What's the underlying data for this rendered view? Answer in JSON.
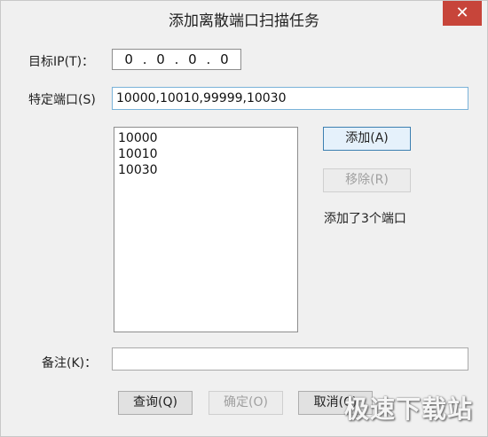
{
  "window": {
    "title": "添加离散端口扫描任务",
    "close_glyph": "✕"
  },
  "target_ip": {
    "label": "目标IP(T)：",
    "octets": [
      "0",
      "0",
      "0",
      "0"
    ]
  },
  "ports": {
    "label": "特定端口(S)",
    "value": "10000,10010,99999,10030"
  },
  "port_list": {
    "items": [
      "10000",
      "10010",
      "10030"
    ]
  },
  "buttons": {
    "add": "添加(A)",
    "remove": "移除(R)",
    "query": "查询(Q)",
    "ok": "确定(O)",
    "cancel": "取消(C)"
  },
  "status_text": "添加了3个端口",
  "note": {
    "label": "备注(K)：",
    "value": ""
  },
  "watermark": "极速下载站"
}
